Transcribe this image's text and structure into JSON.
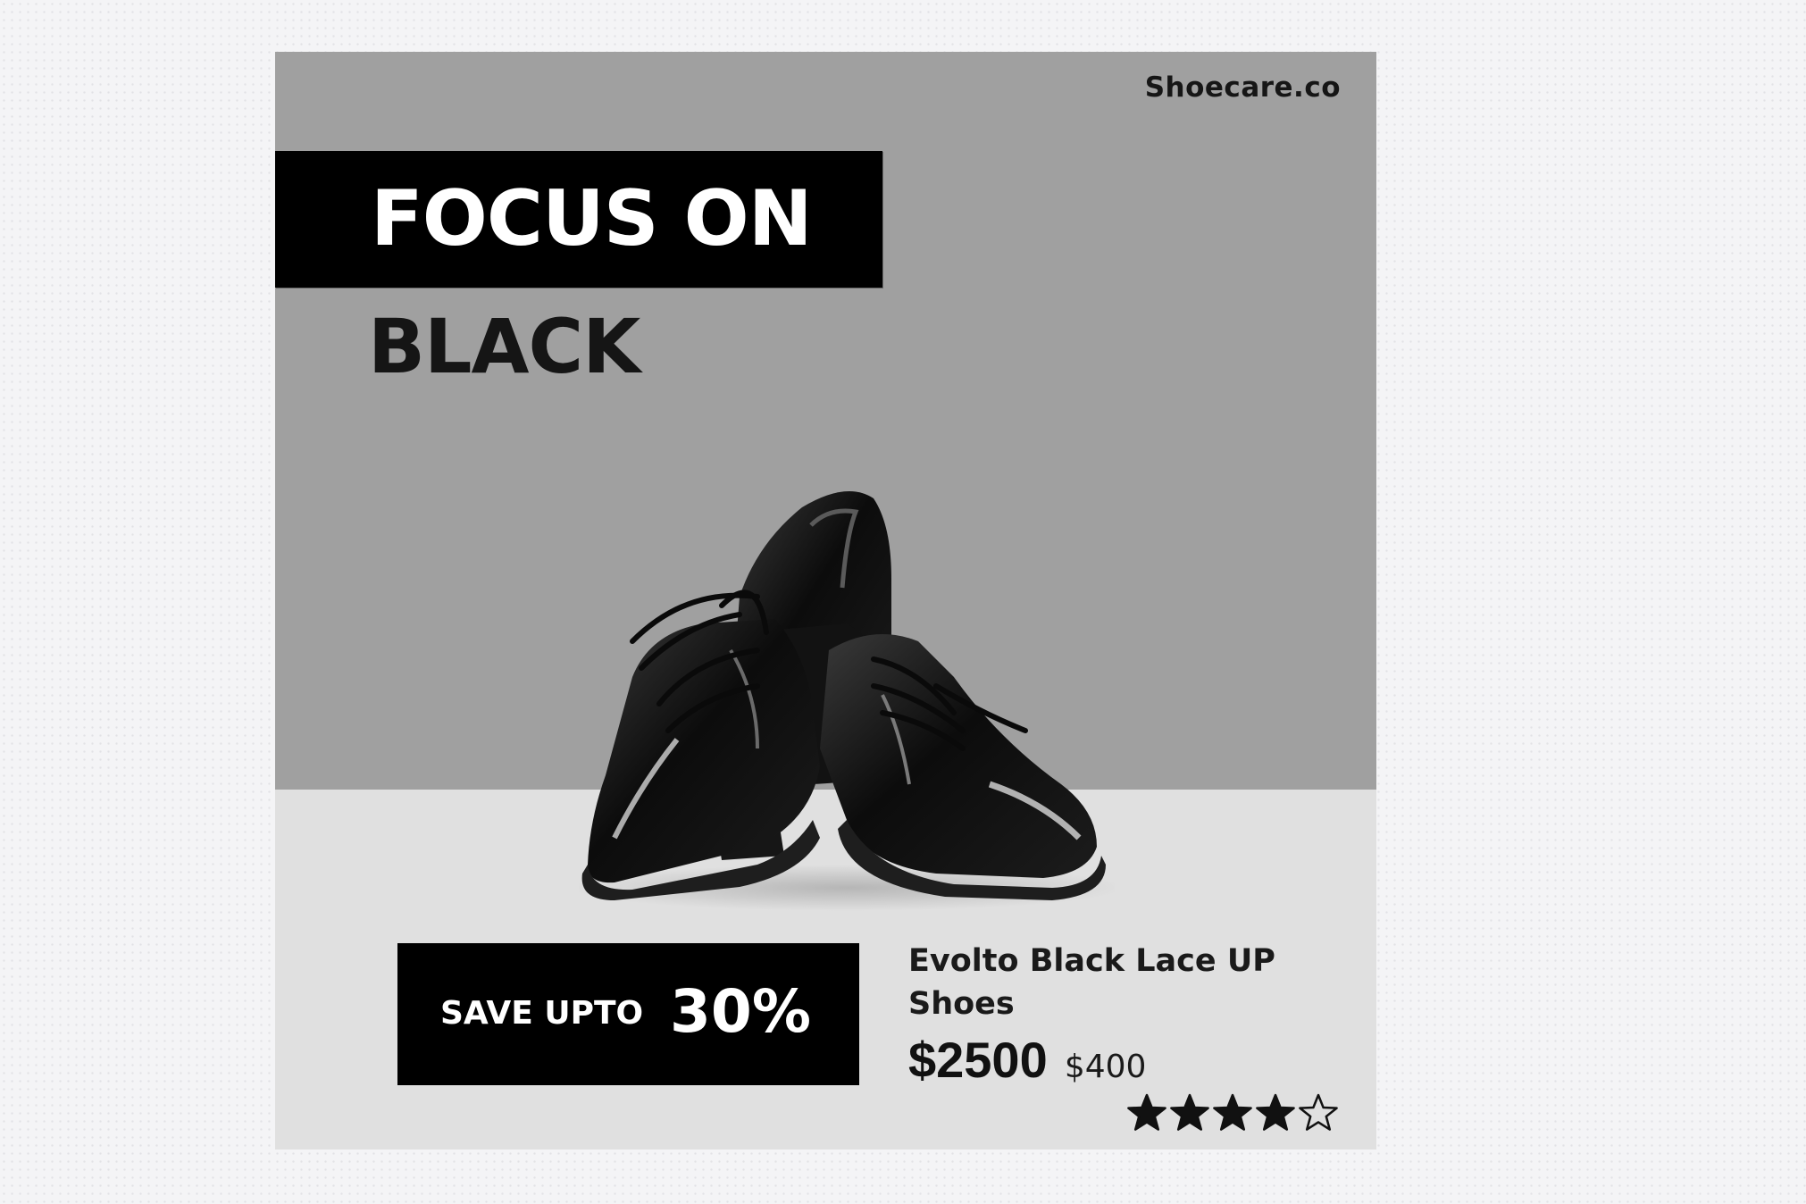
{
  "brand": "Shoecare.co",
  "headline": {
    "line1": "FOCUS ON",
    "line2": "BLACK"
  },
  "promo": {
    "save_label": "SAVE UPTO",
    "save_percent": "30%"
  },
  "product": {
    "name": "Evolto Black Lace UP Shoes",
    "price_current": "$2500",
    "price_old": "$400",
    "image": "black-patent-lace-up-shoes",
    "rating": 4,
    "rating_max": 5
  },
  "colors": {
    "backdrop": "#a0a0a0",
    "floor": "#e0e0e0",
    "banner": "#000000",
    "text_dark": "#151515"
  }
}
